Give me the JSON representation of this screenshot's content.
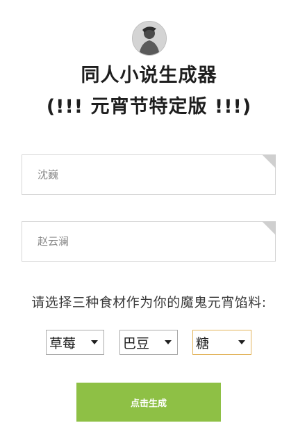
{
  "header": {
    "title_line1": "同人小说生成器",
    "title_line2": "(!!! 元宵节特定版 !!!)"
  },
  "inputs": [
    {
      "placeholder": "沈巍"
    },
    {
      "placeholder": "赵云澜"
    }
  ],
  "prompt": "请选择三种食材作为你的魔鬼元宵馅料:",
  "selects": [
    {
      "value": "草莓"
    },
    {
      "value": "巴豆"
    },
    {
      "value": "糖"
    }
  ],
  "generate_button": "点击生成"
}
